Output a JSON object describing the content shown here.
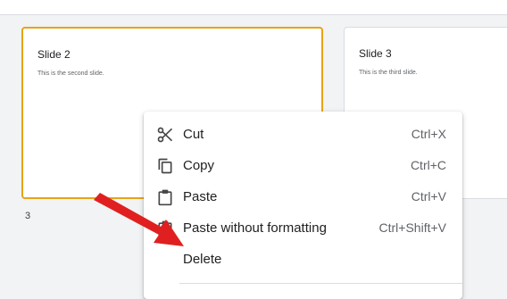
{
  "slides": [
    {
      "title": "Slide 2",
      "subtitle": "This is the second slide."
    },
    {
      "title": "Slide 3",
      "subtitle": "This is the third slide."
    }
  ],
  "slide_number": "3",
  "context_menu": {
    "items": [
      {
        "icon": "scissors-icon",
        "label": "Cut",
        "shortcut": "Ctrl+X"
      },
      {
        "icon": "copy-icon",
        "label": "Copy",
        "shortcut": "Ctrl+C"
      },
      {
        "icon": "clipboard-icon",
        "label": "Paste",
        "shortcut": "Ctrl+V"
      },
      {
        "icon": "paste-plain-icon",
        "label": "Paste without formatting",
        "shortcut": "Ctrl+Shift+V"
      },
      {
        "icon": "",
        "label": "Delete",
        "shortcut": ""
      }
    ]
  },
  "colors": {
    "selection": "#e8a317",
    "annotation_arrow": "#e02020",
    "icon": "#444746"
  }
}
